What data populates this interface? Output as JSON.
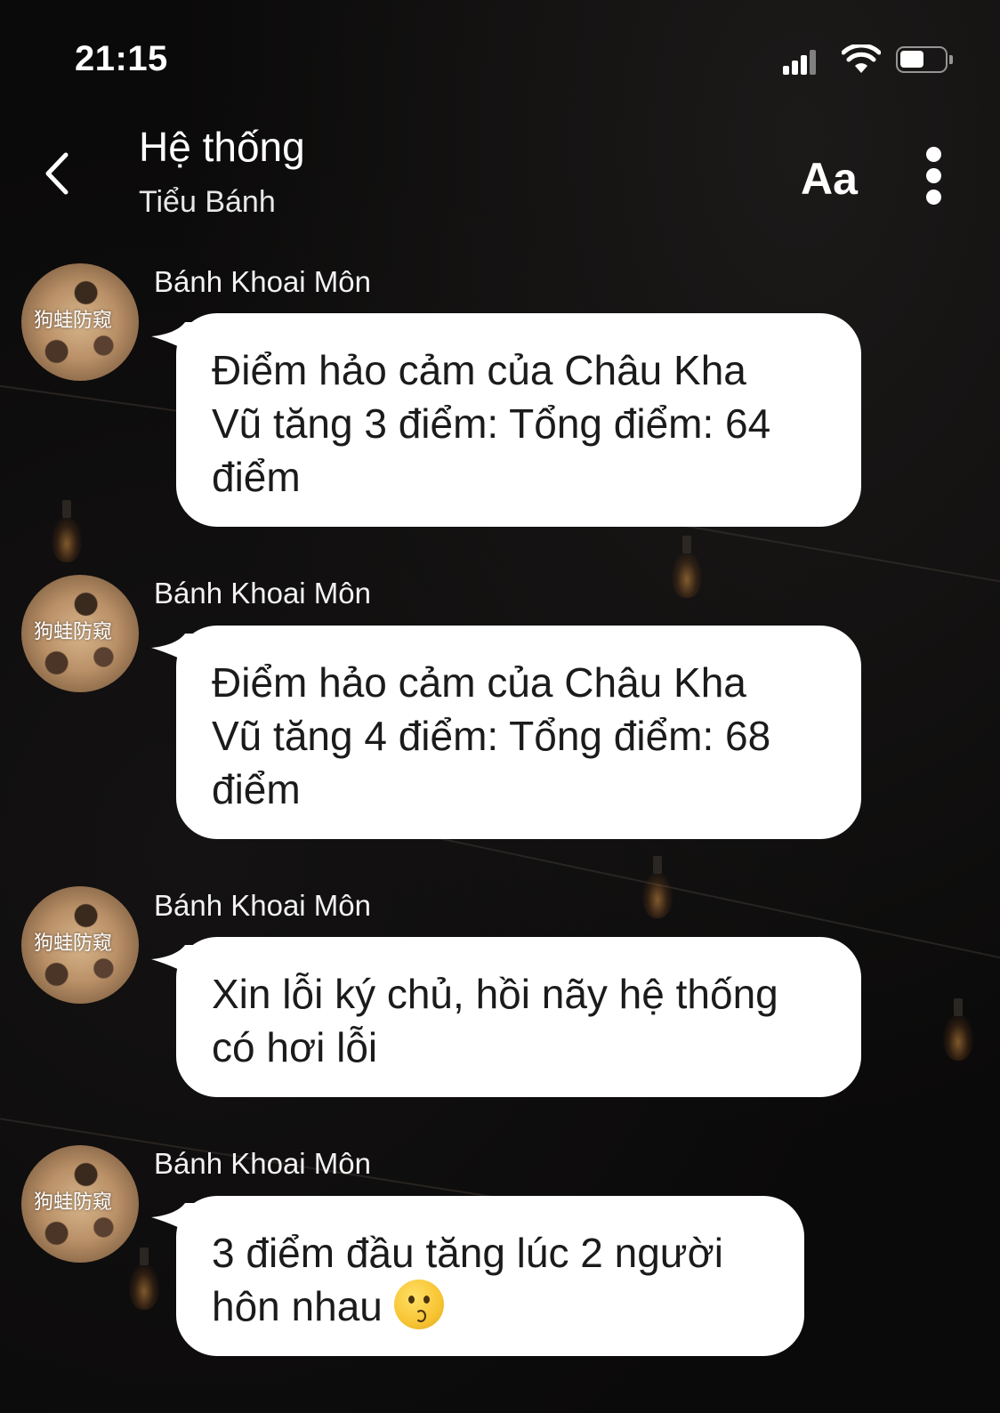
{
  "status_bar": {
    "time": "21:15"
  },
  "header": {
    "title": "Hệ thống",
    "subtitle": "Tiểu Bánh",
    "font_button": "Aa"
  },
  "messages": [
    {
      "sender": "Bánh Khoai Môn",
      "avatar_watermark": "狗蛙防窥",
      "lines": [
        "Điểm hảo cảm của Châu Kha",
        "Vũ tăng 3 điểm: Tổng điểm: 64",
        "điểm"
      ]
    },
    {
      "sender": "Bánh Khoai Môn",
      "avatar_watermark": "狗蛙防窥",
      "lines": [
        "Điểm hảo cảm của Châu Kha",
        "Vũ tăng 4 điểm: Tổng điểm: 68",
        "điểm"
      ]
    },
    {
      "sender": "Bánh Khoai Môn",
      "avatar_watermark": "狗蛙防窥",
      "lines": [
        "Xin lỗi ký chủ, hồi nãy hệ thống",
        "có hơi lỗi"
      ]
    },
    {
      "sender": "Bánh Khoai Môn",
      "avatar_watermark": "狗蛙防窥",
      "lines": [
        "3 điểm đầu tăng lúc 2 người",
        "hôn nhau"
      ],
      "trailing_emoji": "kissing-face-icon"
    }
  ],
  "colors": {
    "background": "#0b0a0a",
    "bubble": "#ffffff",
    "bubble_text": "#1b1b1b"
  }
}
